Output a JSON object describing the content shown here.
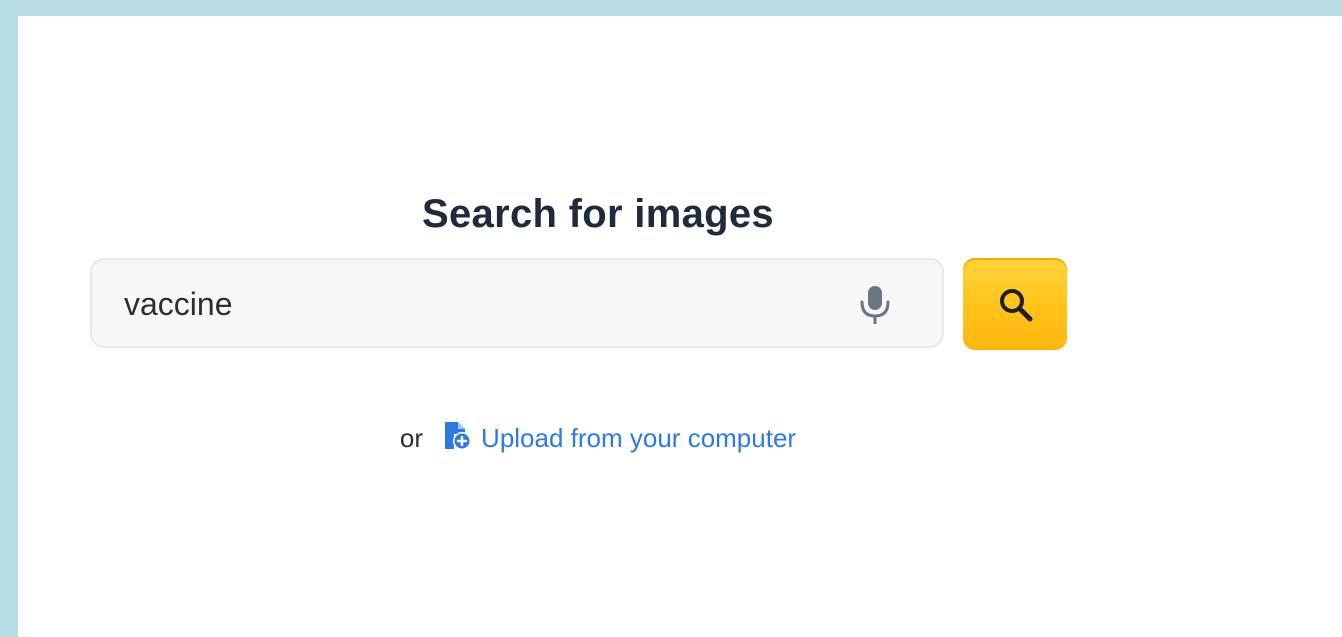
{
  "page": {
    "title": "Search for images"
  },
  "search": {
    "value": "vaccine",
    "placeholder": "",
    "mic_icon": "microphone-icon",
    "button_icon": "search-icon",
    "button_color": "#FFC21A"
  },
  "upload": {
    "or_text": "or",
    "link_text": "Upload from your computer",
    "icon": "file-upload-icon",
    "link_color": "#2D7BE0"
  }
}
